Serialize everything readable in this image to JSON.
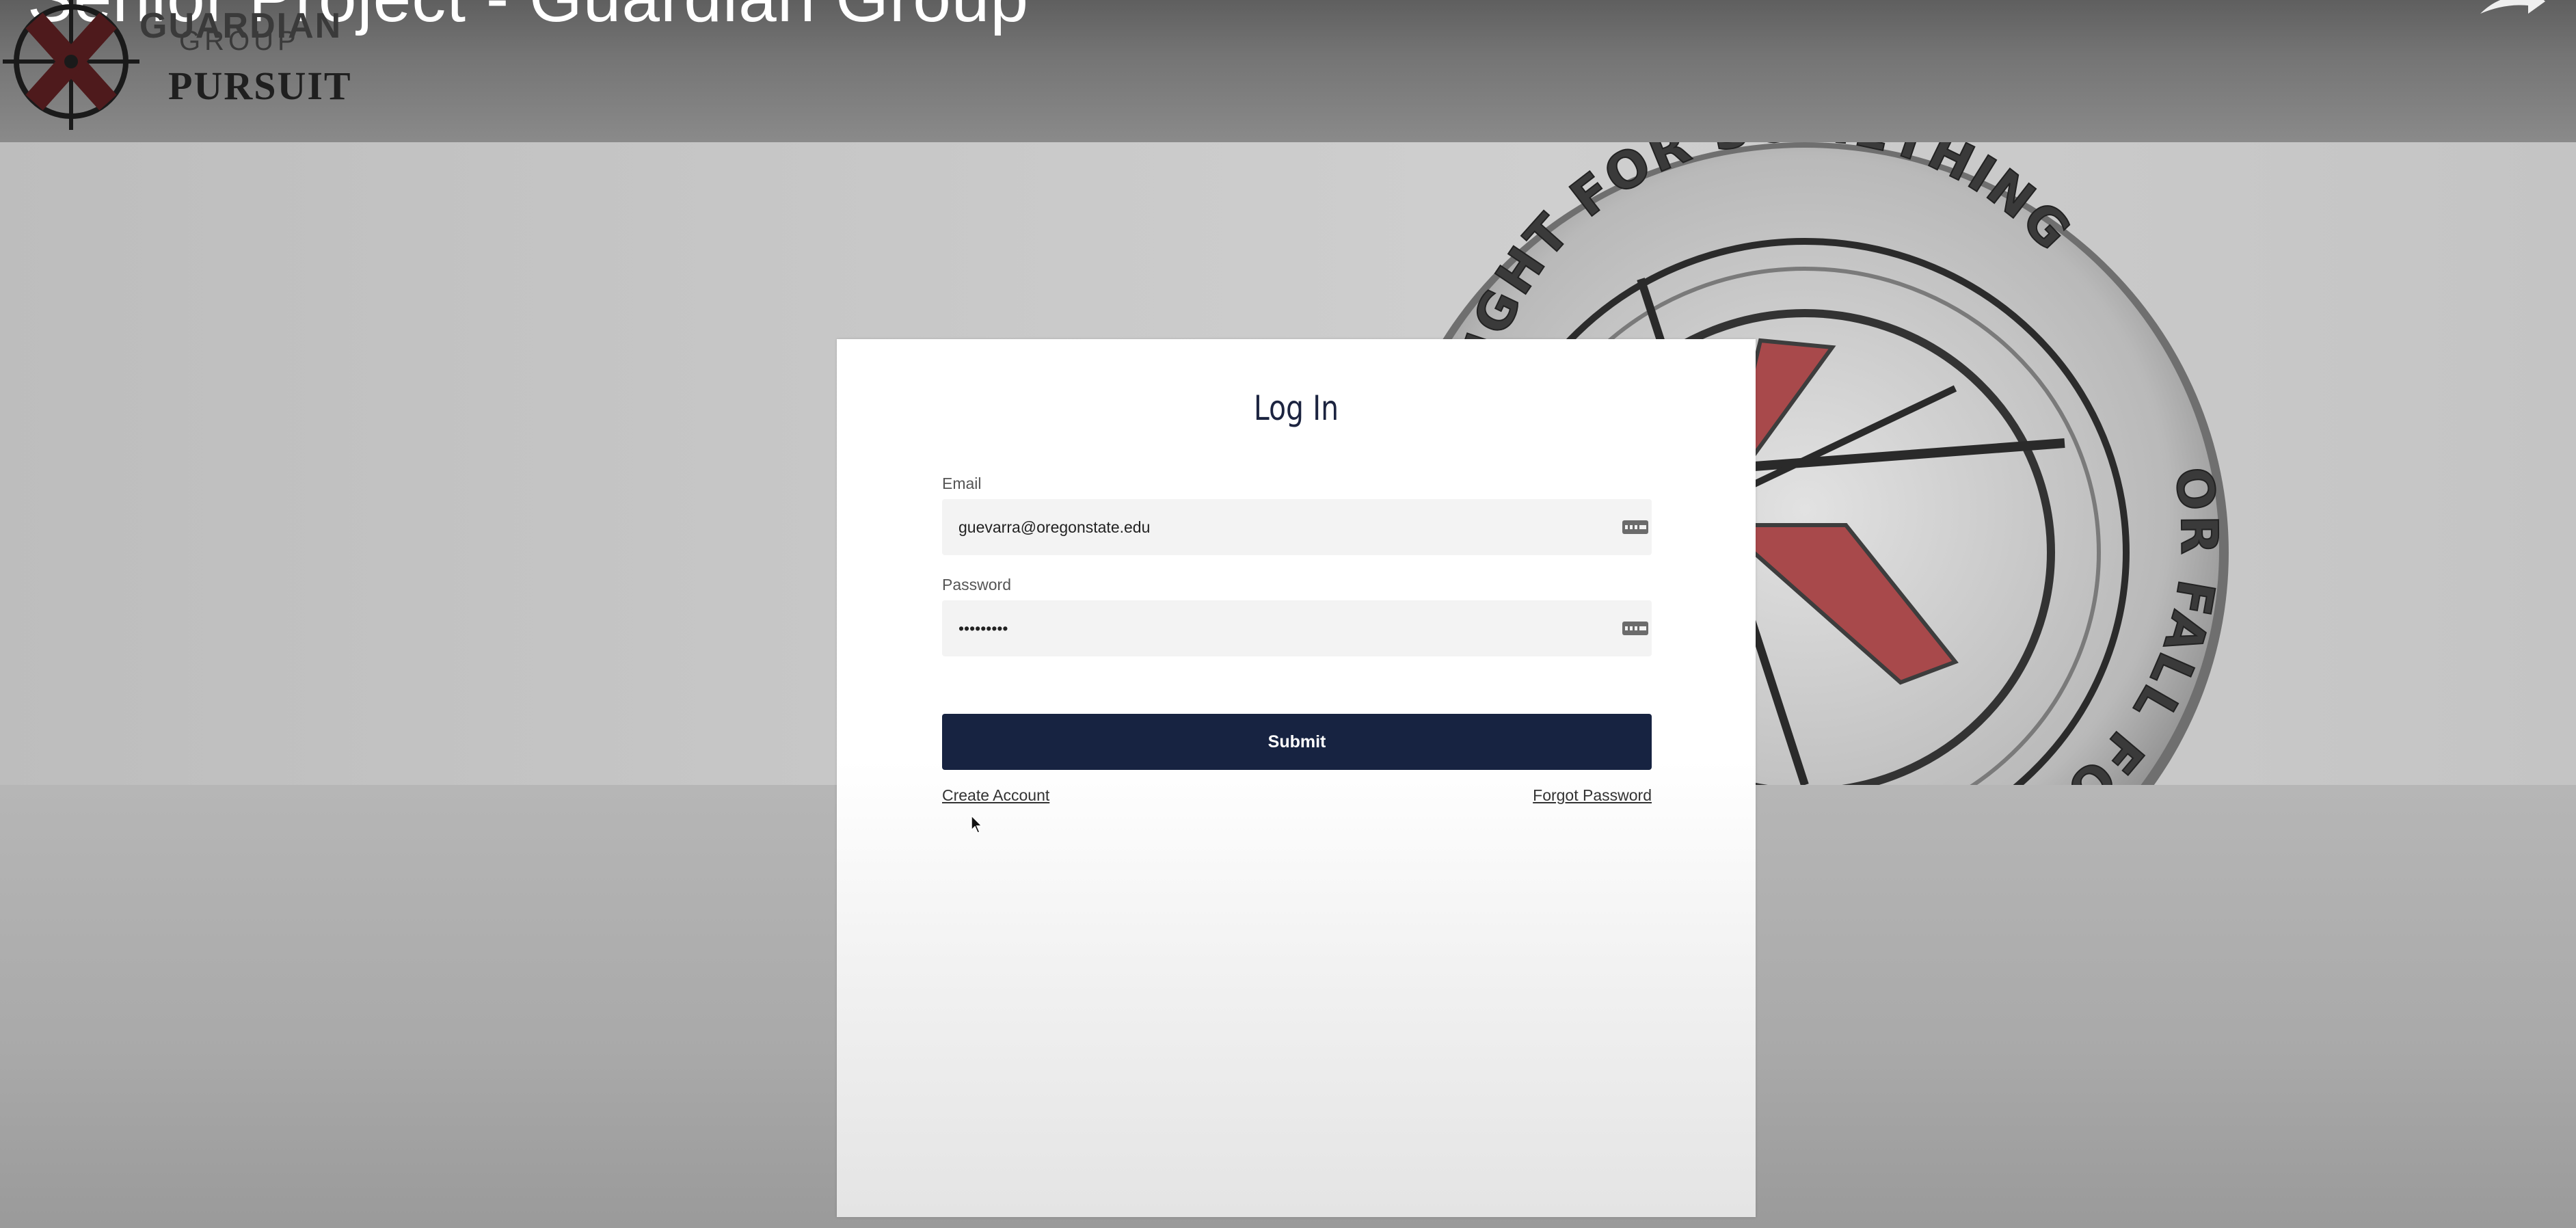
{
  "video": {
    "title": "Senior Project - Guardian Group"
  },
  "header": {
    "logo_line1": "GUARDIAN",
    "logo_line2": "GROUP",
    "logo_line3": "PURSUIT",
    "logo_icon": "crosshair-x-logo"
  },
  "hero": {
    "coin_text_top": "TO FIGHT FOR SOMETHING",
    "coin_text_bottom": "OR FALL FOR NOTHING"
  },
  "login": {
    "title": "Log In",
    "email_label": "Email",
    "email_value": "guevarra@oregonstate.edu",
    "password_label": "Password",
    "password_value": "•••••••••",
    "field_icon": "password-manager-icon",
    "submit_label": "Submit",
    "create_account_label": "Create Account",
    "forgot_password_label": "Forgot Password"
  },
  "colors": {
    "primary": "#172341",
    "title_text": "#1c2440",
    "input_bg": "#f3f3f3",
    "coin_red": "#a8494b"
  }
}
